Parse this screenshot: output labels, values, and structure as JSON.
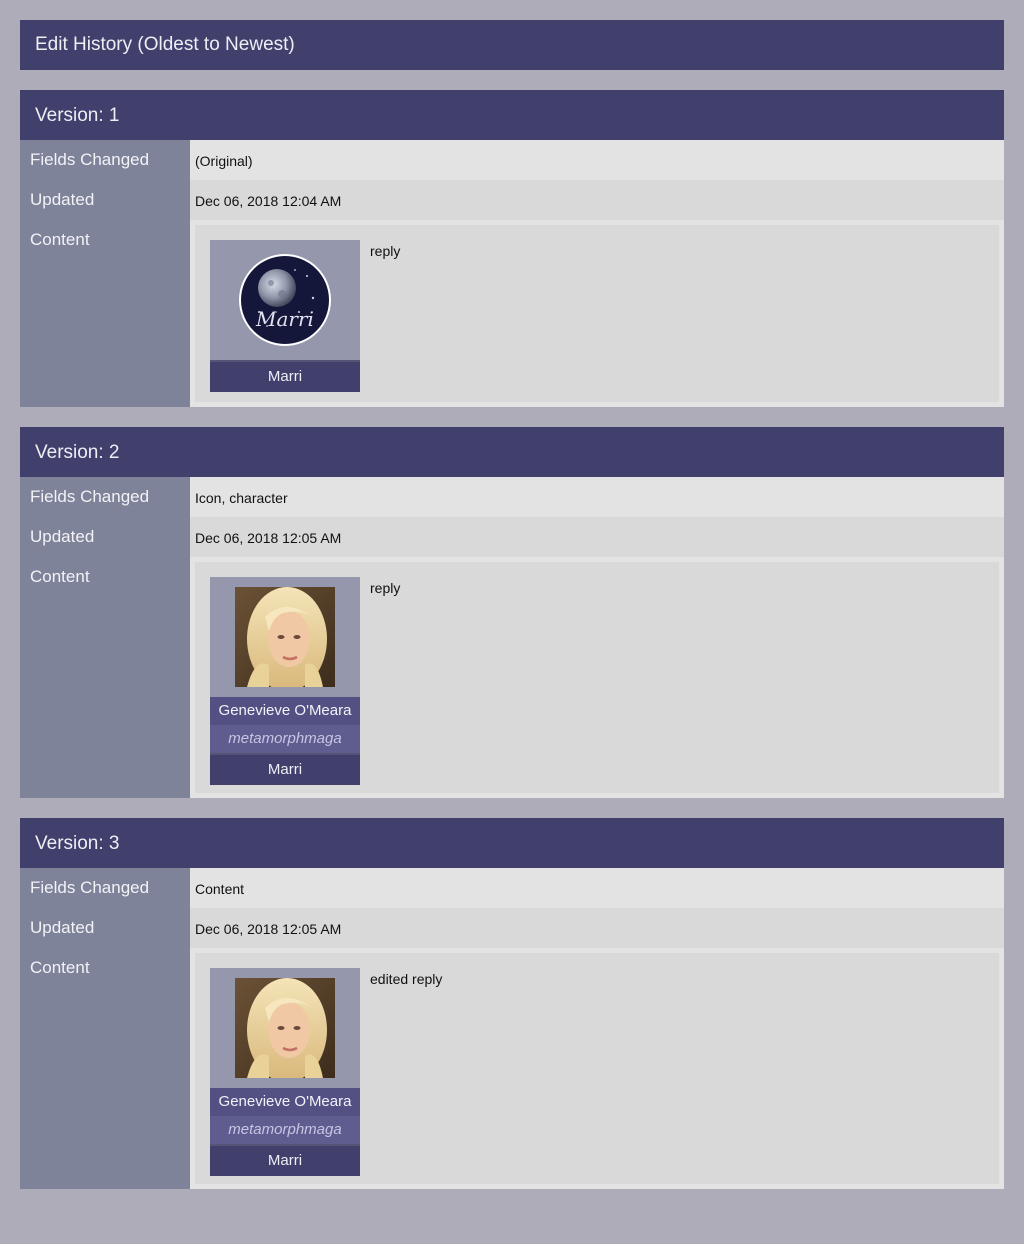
{
  "page": {
    "title": "Edit History (Oldest to Newest)"
  },
  "labels": {
    "fields_changed": "Fields Changed",
    "updated": "Updated",
    "content": "Content"
  },
  "versions": [
    {
      "heading": "Version: 1",
      "fields_changed": "(Original)",
      "updated": "Dec 06, 2018 12:04 AM",
      "icon": "moon-logo-icon",
      "icon_lettering": "Marri",
      "character": "",
      "screenname": "",
      "user": "Marri",
      "text": "reply"
    },
    {
      "heading": "Version: 2",
      "fields_changed": "Icon, character",
      "updated": "Dec 06, 2018 12:05 AM",
      "icon": "portrait-icon",
      "character": "Genevieve O'Meara",
      "screenname": "metamorphmaga",
      "user": "Marri",
      "text": "reply"
    },
    {
      "heading": "Version: 3",
      "fields_changed": "Content",
      "updated": "Dec 06, 2018 12:05 AM",
      "icon": "portrait-icon",
      "character": "Genevieve O'Meara",
      "screenname": "metamorphmaga",
      "user": "Marri",
      "text": "edited reply"
    }
  ],
  "colors": {
    "background": "#aeacb9",
    "header": "#413f6c",
    "label_column": "#7f8399",
    "icon_panel": "#9597ad"
  }
}
